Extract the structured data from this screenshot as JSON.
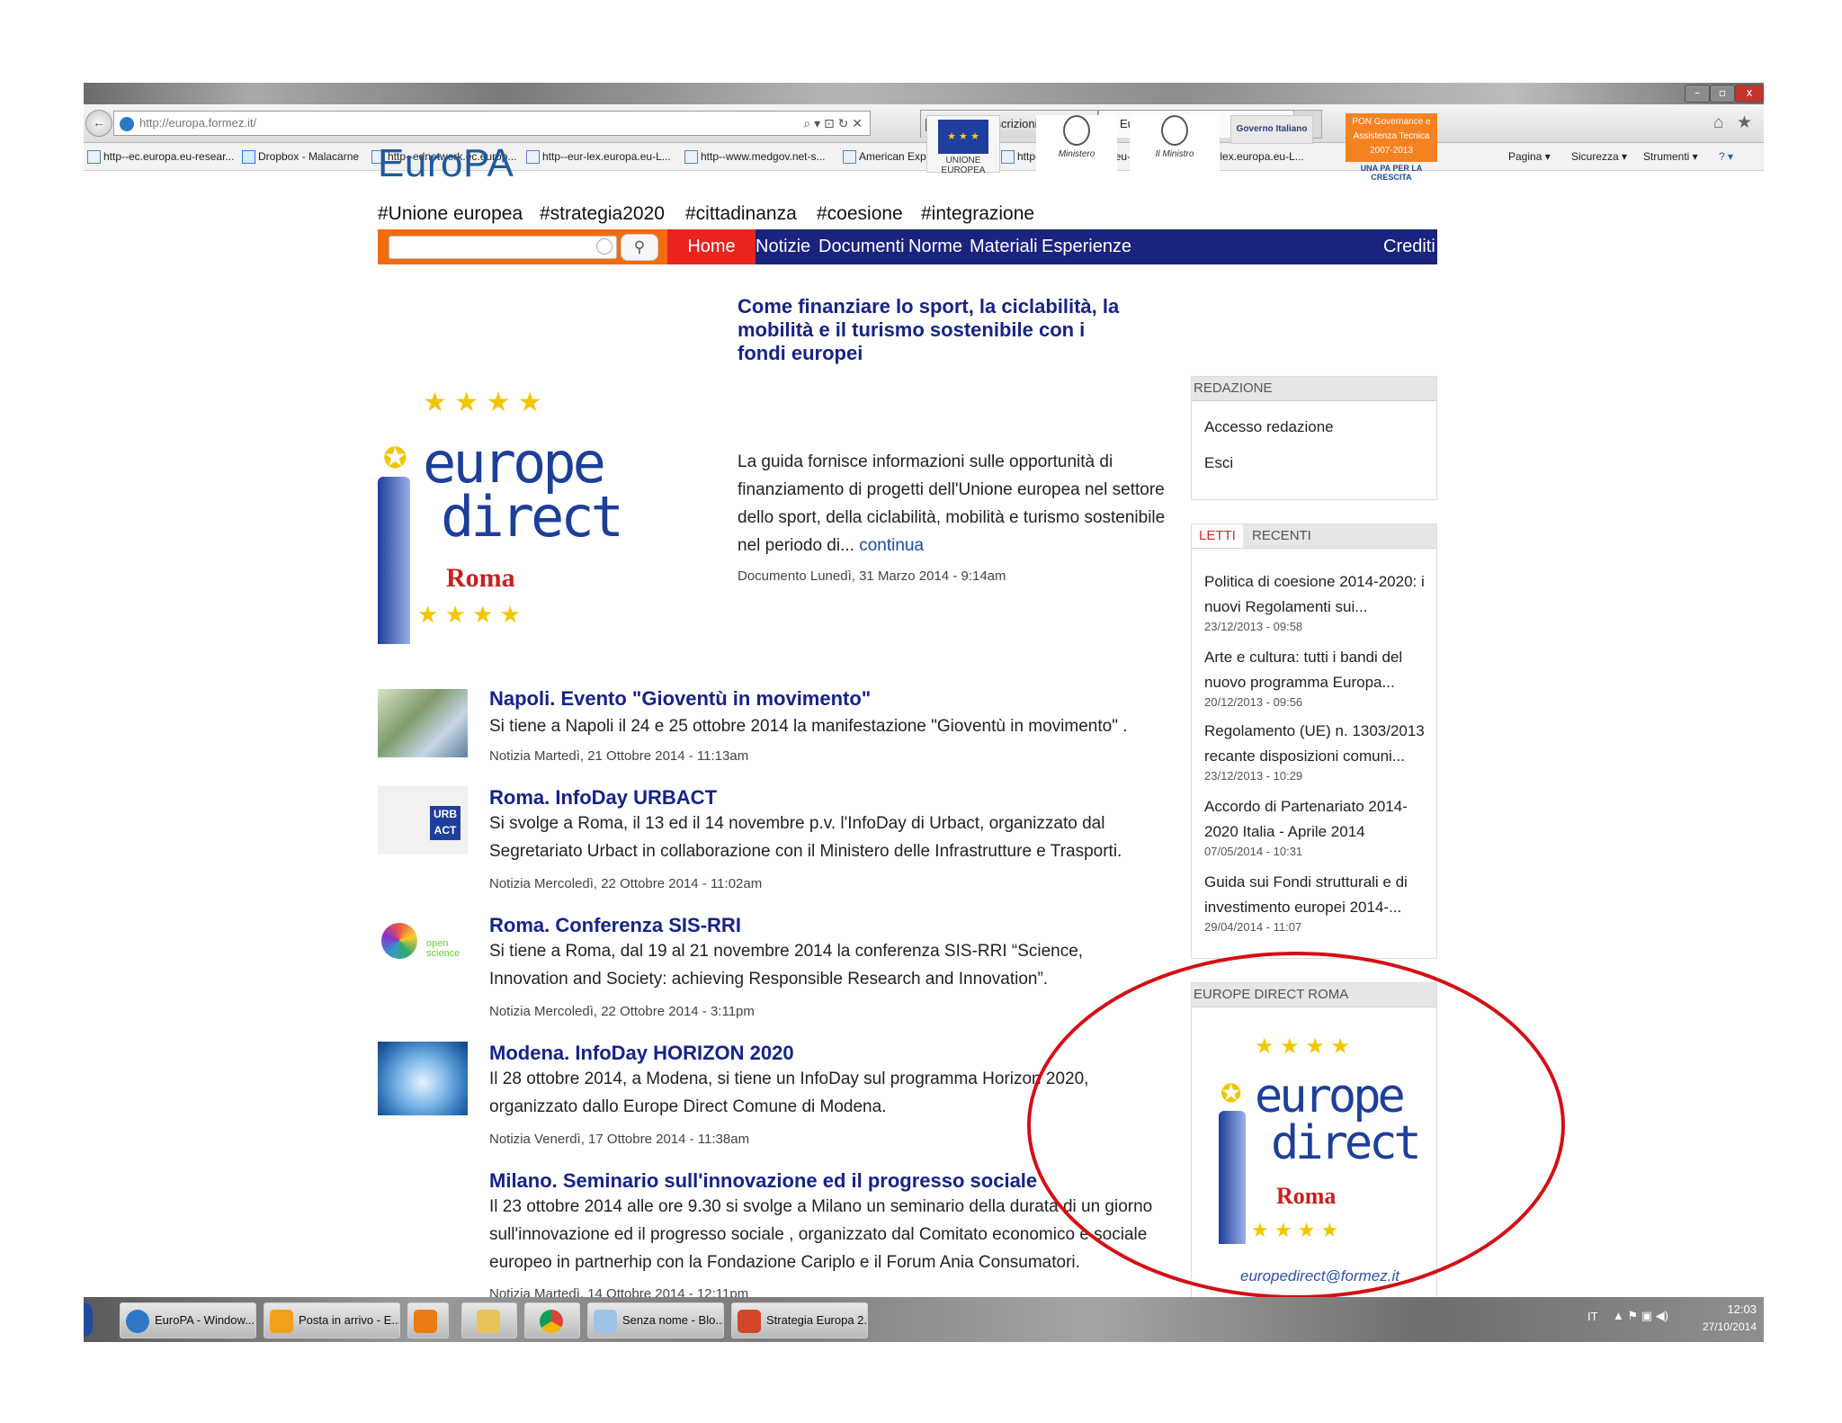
{
  "browser": {
    "address_url": "http://europa.formez.it/",
    "tabs": [
      "Gestione iscrizioni evento | Eve...",
      "EuroPA"
    ],
    "tab_close": "×",
    "window_buttons": [
      "–",
      "▫",
      "x"
    ],
    "favorites": [
      "http--ec.europa.eu-resear...",
      "Dropbox - Malacarne",
      "http--ednetwork.ec.europ...",
      "http--eur-lex.europa.eu-L...",
      "http--www.medgov.net-s...",
      "American Express-Carte-R...",
      "http--eur-lex.europa.eu-L...",
      "http--eur-lex.europa.eu-L..."
    ],
    "tools": [
      "Pagina ▾",
      "Sicurezza ▾",
      "Strumenti ▾"
    ]
  },
  "site": {
    "logo": "EuroPA",
    "sponsors": [
      "UNIONE EUROPEA",
      "Ministero",
      "Il Ministro",
      "Governo Italiano",
      "PON Governance e Assistenza Tecnica 2007-2013"
    ],
    "sponsor_tagline": "UNA PA PER LA CRESCITA",
    "hashtags": [
      "#Unione europea",
      "#strategia2020",
      "#cittadinanza",
      "#coesione",
      "#integrazione"
    ],
    "menu": [
      "Home",
      "Notizie",
      "Documenti",
      "Norme",
      "Materiali",
      "Esperienze"
    ],
    "menu_right": "Crediti"
  },
  "europe_direct": {
    "word1": "europe",
    "word2": "direct",
    "city": "Roma",
    "email": "europedirect@formez.it"
  },
  "featured": {
    "title": "Come finanziare lo sport, la ciclabilità, la mobilità e il turismo sostenibile con i fondi europei",
    "body": "La guida fornisce informazioni sulle opportunità di finanziamento di progetti dell'Unione europea nel settore dello sport, della ciclabilità, mobilità e turismo sostenibile nel periodo di...",
    "more": "continua",
    "meta": "Documento Lunedì, 31 Marzo 2014 - 9:14am"
  },
  "news": [
    {
      "title": "Napoli. Evento \"Gioventù in movimento\"",
      "body": "Si tiene a Napoli il 24 e 25 ottobre 2014 la manifestazione \"Gioventù in movimento\" .",
      "meta": "Notizia Martedì, 21 Ottobre 2014 - 11:13am"
    },
    {
      "title": "Roma. InfoDay URBACT",
      "body": "Si svolge a Roma, il 13 ed il 14 novembre p.v. l'InfoDay di Urbact, organizzato dal Segretariato Urbact in collaborazione con il Ministero delle Infrastrutture e Trasporti.",
      "meta": "Notizia Mercoledì, 22 Ottobre 2014 - 11:02am"
    },
    {
      "title": "Roma. Conferenza SIS-RRI",
      "body": "Si tiene a Roma, dal 19 al 21 novembre 2014 la conferenza SIS-RRI “Science, Innovation and Society: achieving Responsible Research and Innovation”.",
      "meta": "Notizia Mercoledì, 22 Ottobre 2014 - 3:11pm"
    },
    {
      "title": "Modena. InfoDay HORIZON 2020",
      "body": "Il 28 ottobre 2014, a Modena, si tiene un InfoDay sul programma Horizon 2020, organizzato dallo Europe Direct Comune di Modena.",
      "meta": "Notizia Venerdì, 17 Ottobre 2014 - 11:38am"
    },
    {
      "title": "Milano. Seminario sull'innovazione ed il progresso sociale",
      "body": "Il 23 ottobre 2014 alle ore 9.30 si svolge a Milano un seminario della durata di un giorno sull'innovazione ed il progresso sociale , organizzato dal Comitato economico e sociale europeo in partnerhip con la Fondazione Cariplo e il Forum Ania Consumatori.",
      "meta": "Notizia Martedì, 14 Ottobre 2014 - 12:11pm"
    }
  ],
  "thumb_labels": {
    "urbact_1": "URB",
    "urbact_2": "ACT",
    "open_science": "open science"
  },
  "sidebar": {
    "redazione": {
      "title": "REDAZIONE",
      "links": [
        "Accesso redazione",
        "Esci"
      ]
    },
    "tabs": [
      "LETTI",
      "RECENTI"
    ],
    "items": [
      {
        "title": "Politica di coesione 2014-2020: i nuovi Regolamenti sui...",
        "date": "23/12/2013 - 09:58"
      },
      {
        "title": "Arte e cultura: tutti i bandi del nuovo programma Europa...",
        "date": "20/12/2013 - 09:56"
      },
      {
        "title": "Regolamento (UE) n. 1303/2013 recante disposizioni comuni...",
        "date": "23/12/2013 - 10:29"
      },
      {
        "title": "Accordo di Partenariato 2014-2020 Italia - Aprile 2014",
        "date": "07/05/2014 - 10:31"
      },
      {
        "title": "Guida sui Fondi strutturali e di investimento europei 2014-...",
        "date": "29/04/2014 - 11:07"
      }
    ],
    "europe_direct_title": "EUROPE DIRECT ROMA"
  },
  "taskbar": {
    "items": [
      "EuroPA - Window...",
      "Posta in arrivo - E...",
      "Senza nome - Blo...",
      "Strategia Europa 2..."
    ],
    "lang": "IT",
    "time": "12:03",
    "date": "27/10/2014"
  },
  "colors": {
    "menu_bg": "#1a237e",
    "home_bg": "#e8241c",
    "search_bg": "#f26c0f",
    "title_blue": "#15238a",
    "annotation": "#d40f14"
  }
}
